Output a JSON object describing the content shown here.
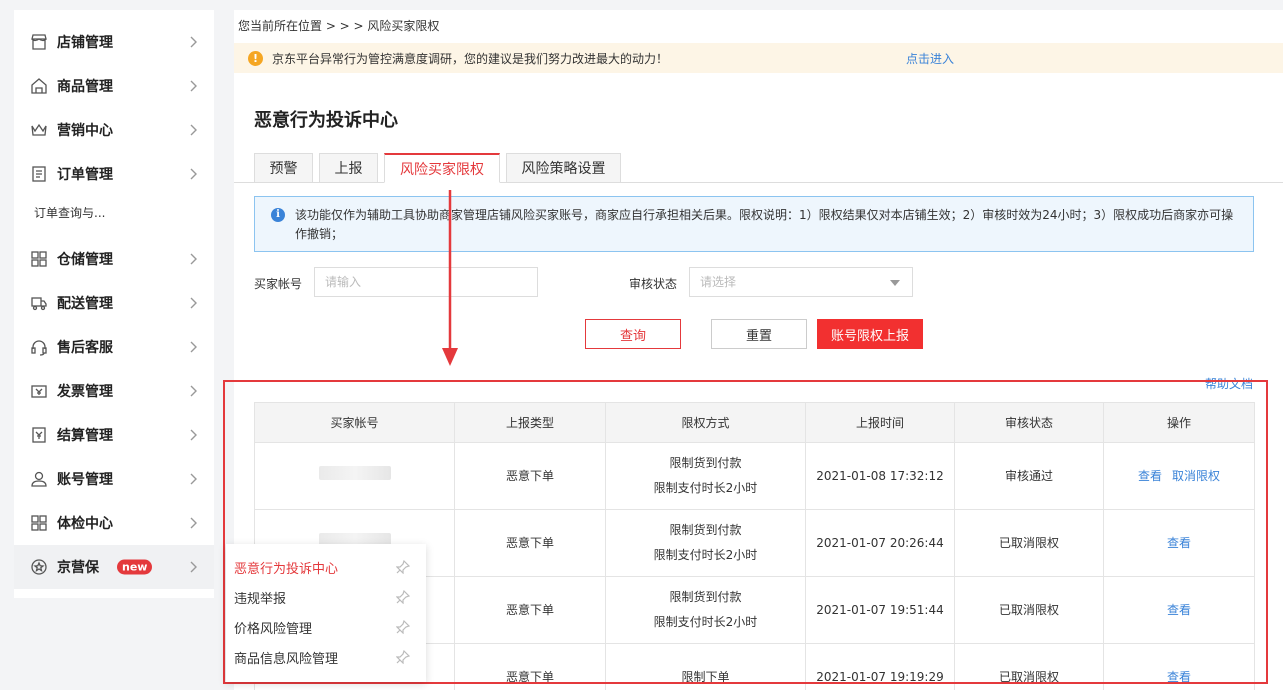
{
  "sidebar": {
    "items": [
      {
        "label": "店铺管理",
        "icon": "store-icon"
      },
      {
        "label": "商品管理",
        "icon": "bag-icon"
      },
      {
        "label": "营销中心",
        "icon": "crown-icon"
      },
      {
        "label": "订单管理",
        "icon": "document-icon"
      },
      {
        "label": "仓储管理",
        "icon": "grid-icon"
      },
      {
        "label": "配送管理",
        "icon": "truck-icon"
      },
      {
        "label": "售后客服",
        "icon": "headset-icon"
      },
      {
        "label": "发票管理",
        "icon": "invoice-icon"
      },
      {
        "label": "结算管理",
        "icon": "settlement-icon"
      },
      {
        "label": "账号管理",
        "icon": "user-icon"
      },
      {
        "label": "体检中心",
        "icon": "grid-icon"
      },
      {
        "label": "京营保",
        "icon": "shield-badge-icon",
        "badge": "new"
      }
    ],
    "sub_item": "订单查询与..."
  },
  "flyout": {
    "items": [
      "恶意行为投诉中心",
      "违规举报",
      "价格风险管理",
      "商品信息风险管理"
    ]
  },
  "breadcrumb": "您当前所在位置 > > > 风险买家限权",
  "notice": {
    "text": "京东平台异常行为管控满意度调研，您的建议是我们努力改进最大的动力！",
    "link": "点击进入"
  },
  "page_title": "恶意行为投诉中心",
  "tabs": [
    "预警",
    "上报",
    "风险买家限权",
    "风险策略设置"
  ],
  "info": "该功能仅作为辅助工具协助商家管理店铺风险买家账号，商家应自行承担相关后果。限权说明：1）限权结果仅对本店铺生效；2）审核时效为24小时；3）限权成功后商家亦可操作撤销；",
  "filters": {
    "buyer_label": "买家帐号",
    "buyer_placeholder": "请输入",
    "status_label": "审核状态",
    "status_placeholder": "请选择"
  },
  "buttons": {
    "query": "查询",
    "reset": "重置",
    "report": "账号限权上报"
  },
  "help_link": "帮助文档",
  "table": {
    "headers": [
      "买家帐号",
      "上报类型",
      "限权方式",
      "上报时间",
      "审核状态",
      "操作"
    ],
    "rows": [
      {
        "type": "恶意下单",
        "method1": "限制货到付款",
        "method2": "限制支付时长2小时",
        "time": "2021-01-08 17:32:12",
        "status": "审核通过",
        "action1": "查看",
        "action2": "取消限权"
      },
      {
        "type": "恶意下单",
        "method1": "限制货到付款",
        "method2": "限制支付时长2小时",
        "time": "2021-01-07 20:26:44",
        "status": "已取消限权",
        "action1": "查看"
      },
      {
        "type": "恶意下单",
        "method1": "限制货到付款",
        "method2": "限制支付时长2小时",
        "time": "2021-01-07 19:51:44",
        "status": "已取消限权",
        "action1": "查看"
      },
      {
        "type": "恶意下单",
        "method1": "限制下单",
        "time": "2021-01-07 19:19:29",
        "status": "已取消限权",
        "action1": "查看"
      }
    ]
  },
  "colors": {
    "brand_red": "#e4393c",
    "link_blue": "#3a83d8",
    "notice_bg": "#fdf5e6"
  }
}
